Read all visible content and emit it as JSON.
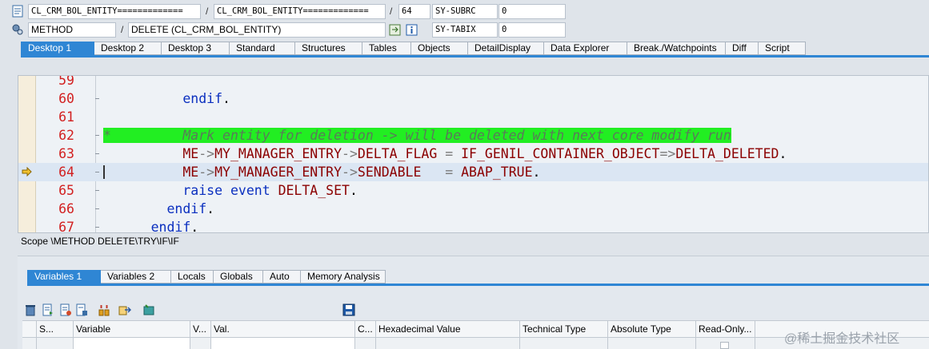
{
  "header": {
    "row1": {
      "field_program": "CL_CRM_BOL_ENTITY=============",
      "field_include": "CL_CRM_BOL_ENTITY=============",
      "separator1": "/",
      "separator2": "/",
      "line": "64",
      "sysvar_label": "SY-SUBRC",
      "sysvar_value": "0"
    },
    "row2": {
      "field_type": "METHOD",
      "separator": "/",
      "field_event": "DELETE (CL_CRM_BOL_ENTITY)",
      "sysvar_label": "SY-TABIX",
      "sysvar_value": "0"
    }
  },
  "desktop_tabs": [
    {
      "label": "Desktop 1",
      "active": true
    },
    {
      "label": "Desktop 2",
      "active": false
    },
    {
      "label": "Desktop 3",
      "active": false
    },
    {
      "label": "Standard",
      "active": false
    },
    {
      "label": "Structures",
      "active": false
    },
    {
      "label": "Tables",
      "active": false
    },
    {
      "label": "Objects",
      "active": false
    },
    {
      "label": "DetailDisplay",
      "active": false
    },
    {
      "label": "Data Explorer",
      "active": false
    },
    {
      "label": "Break./Watchpoints",
      "active": false
    },
    {
      "label": "Diff",
      "active": false
    },
    {
      "label": "Script",
      "active": false
    }
  ],
  "code": {
    "current_line": "64",
    "lines": [
      {
        "num": "59"
      },
      {
        "num": "60",
        "tokens": [
          {
            "t": "kw",
            "v": "endif"
          },
          {
            "t": "plain",
            "v": "."
          }
        ],
        "indent": "          "
      },
      {
        "num": "61"
      },
      {
        "num": "62",
        "comment": "*         Mark entity for deletion -> will be deleted with next core modify run"
      },
      {
        "num": "63",
        "indent": "          ",
        "tokens": [
          {
            "t": "ident",
            "v": "ME"
          },
          {
            "t": "op",
            "v": "->"
          },
          {
            "t": "ident",
            "v": "MY_MANAGER_ENTRY"
          },
          {
            "t": "op",
            "v": "->"
          },
          {
            "t": "ident",
            "v": "DELTA_FLAG"
          },
          {
            "t": "plain",
            "v": " "
          },
          {
            "t": "op",
            "v": "="
          },
          {
            "t": "plain",
            "v": " "
          },
          {
            "t": "ident",
            "v": "IF_GENIL_CONTAINER_OBJECT"
          },
          {
            "t": "op",
            "v": "=>"
          },
          {
            "t": "ident",
            "v": "DELTA_DELETED"
          },
          {
            "t": "plain",
            "v": "."
          }
        ]
      },
      {
        "num": "64",
        "indent": "          ",
        "tokens": [
          {
            "t": "ident",
            "v": "ME"
          },
          {
            "t": "op",
            "v": "->"
          },
          {
            "t": "ident",
            "v": "MY_MANAGER_ENTRY"
          },
          {
            "t": "op",
            "v": "->"
          },
          {
            "t": "ident",
            "v": "SENDABLE"
          },
          {
            "t": "plain",
            "v": "   "
          },
          {
            "t": "op",
            "v": "="
          },
          {
            "t": "plain",
            "v": " "
          },
          {
            "t": "ident",
            "v": "ABAP_TRUE"
          },
          {
            "t": "plain",
            "v": "."
          }
        ]
      },
      {
        "num": "65",
        "indent": "          ",
        "tokens": [
          {
            "t": "kw",
            "v": "raise"
          },
          {
            "t": "plain",
            "v": " "
          },
          {
            "t": "kw",
            "v": "event"
          },
          {
            "t": "plain",
            "v": " "
          },
          {
            "t": "ident",
            "v": "DELTA_SET"
          },
          {
            "t": "plain",
            "v": "."
          }
        ]
      },
      {
        "num": "66",
        "indent": "        ",
        "tokens": [
          {
            "t": "kw",
            "v": "endif"
          },
          {
            "t": "plain",
            "v": "."
          }
        ]
      },
      {
        "num": "67",
        "indent": "      ",
        "tokens": [
          {
            "t": "kw",
            "v": "endif"
          },
          {
            "t": "plain",
            "v": "."
          }
        ]
      }
    ]
  },
  "scope": "Scope \\METHOD DELETE\\TRY\\IF\\IF",
  "variable_tabs": [
    {
      "label": "Variables 1",
      "active": true
    },
    {
      "label": "Variables 2",
      "active": false
    },
    {
      "label": "Locals",
      "active": false
    },
    {
      "label": "Globals",
      "active": false
    },
    {
      "label": "Auto",
      "active": false
    },
    {
      "label": "Memory Analysis",
      "active": false
    }
  ],
  "table": {
    "columns": [
      "S...",
      "Variable",
      "V...",
      "Val.",
      "C...",
      "Hexadecimal Value",
      "Technical Type",
      "Absolute Type",
      "Read-Only..."
    ]
  },
  "watermark": "@稀土掘金技术社区",
  "colors": {
    "tab_active": "#2f86d4",
    "keyword": "#0a2fbf",
    "identifier": "#8b0000",
    "comment_highlight": "#22ee22",
    "line_number": "#d22020"
  }
}
